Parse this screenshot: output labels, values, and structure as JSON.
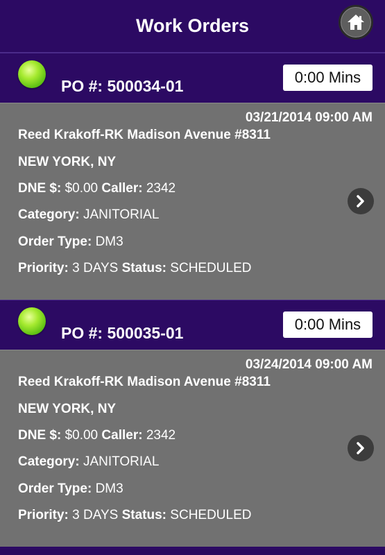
{
  "header": {
    "title": "Work Orders"
  },
  "orders": [
    {
      "po_label": "PO #: 500034-01",
      "mins": "0:00 Mins",
      "date": "03/21/2014 09:00 AM",
      "location": "Reed Krakoff-RK Madison Avenue #8311",
      "city": "NEW YORK, NY",
      "dne_label": "DNE $:",
      "dne_value": "$0.00",
      "caller_label": "Caller:",
      "caller_value": "2342",
      "category_label": "Category:",
      "category_value": "JANITORIAL",
      "order_type_label": "Order Type:",
      "order_type_value": "DM3",
      "priority_label": "Priority:",
      "priority_value": "3 DAYS",
      "status_label": "Status:",
      "status_value": "SCHEDULED"
    },
    {
      "po_label": "PO #: 500035-01",
      "mins": "0:00 Mins",
      "date": "03/24/2014 09:00 AM",
      "location": "Reed Krakoff-RK Madison Avenue #8311",
      "city": "NEW YORK, NY",
      "dne_label": "DNE $:",
      "dne_value": "$0.00",
      "caller_label": "Caller:",
      "caller_value": "2342",
      "category_label": "Category:",
      "category_value": "JANITORIAL",
      "order_type_label": "Order Type:",
      "order_type_value": "DM3",
      "priority_label": "Priority:",
      "priority_value": "3 DAYS",
      "status_label": "Status:",
      "status_value": "SCHEDULED"
    }
  ],
  "colors": {
    "header_bg": "#2c0a63",
    "card_bg": "#717171",
    "status_green": "#6fd21a"
  },
  "icons": {
    "home": "home-icon",
    "chevron": "chevron-right-icon",
    "status": "status-dot-icon"
  }
}
